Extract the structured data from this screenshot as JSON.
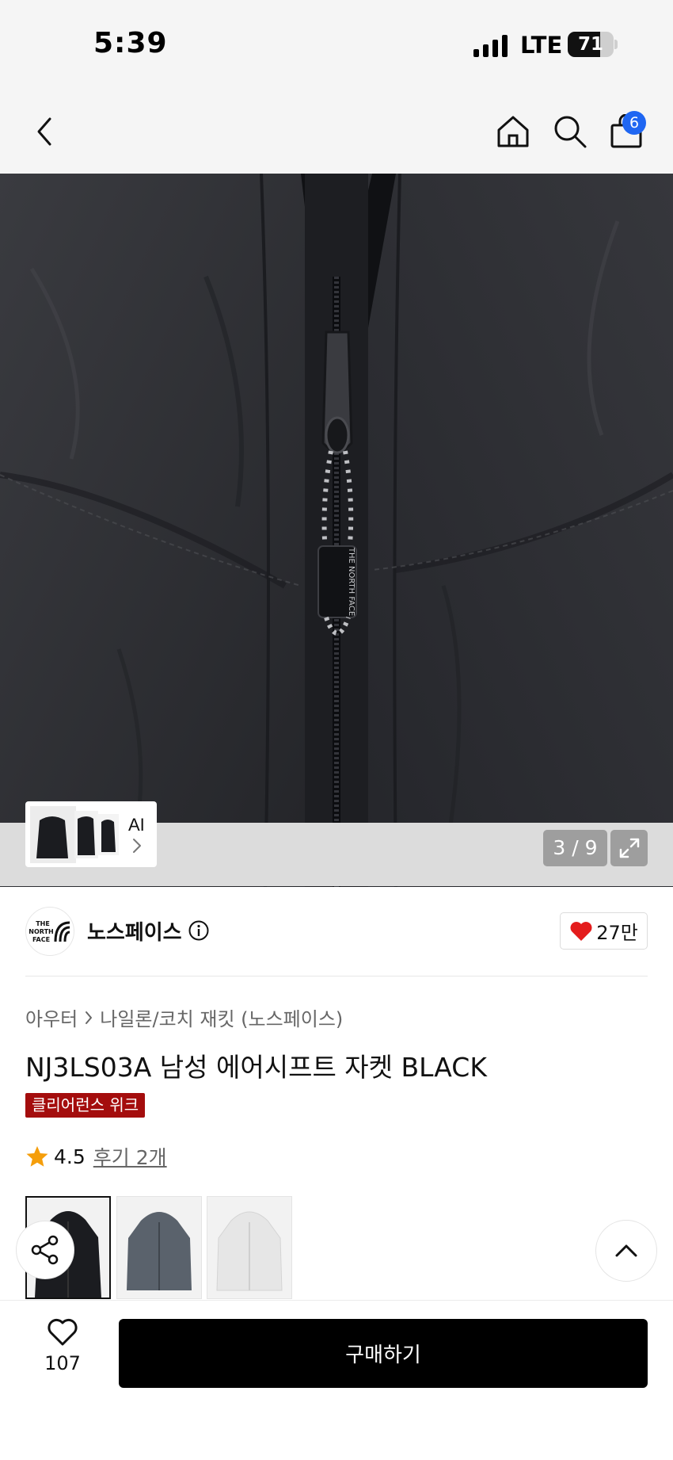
{
  "status_bar": {
    "time": "5:39",
    "network": "LTE",
    "battery_percent": 71,
    "battery_label": "71"
  },
  "nav": {
    "back_icon": "chevron-left-icon",
    "home_icon": "home-icon",
    "search_icon": "search-icon",
    "cart_icon": "shopping-bag-icon",
    "cart_count": "6"
  },
  "gallery": {
    "ai_label": "AI",
    "counter": "3 / 9",
    "expand_icon": "expand-icon"
  },
  "brand": {
    "logo_lines": [
      "THE",
      "NORTH",
      "FACE"
    ],
    "name": "노스페이스",
    "like_count": "27만"
  },
  "product": {
    "breadcrumb": [
      "아우터",
      "나일론/코치 재킷 (노스페이스)"
    ],
    "title": "NJ3LS03A 남성 에어시프트 자켓 BLACK",
    "tag": "클리어런스 위크",
    "rating": "4.5",
    "review_link": "후기 2개"
  },
  "colors": {
    "accent_tag": "#a40d0d",
    "badge": "#1f66f2",
    "star": "#f59e0b",
    "heart": "#e41c1c"
  },
  "actions": {
    "wish_count": "107",
    "buy_label": "구매하기"
  }
}
